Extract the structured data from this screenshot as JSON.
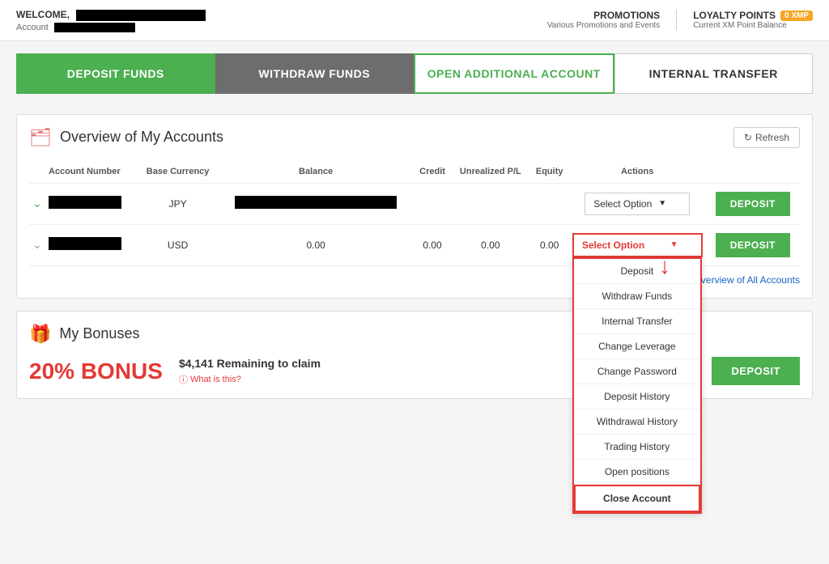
{
  "header": {
    "welcome_text": "WELCOME,",
    "account_label": "Account",
    "promotions_title": "PROMOTIONS",
    "promotions_sub": "Various Promotions and Events",
    "loyalty_title": "LOYALTY POINTS",
    "loyalty_badge": "0 XMP",
    "loyalty_sub": "Current XM Point Balance"
  },
  "nav": {
    "deposit": "DEPOSIT FUNDS",
    "withdraw": "WITHDRAW FUNDS",
    "open_account": "OPEN ADDITIONAL ACCOUNT",
    "transfer": "INTERNAL TRANSFER"
  },
  "accounts_section": {
    "title": "Overview of My Accounts",
    "refresh_label": "Refresh",
    "columns": {
      "account_number": "Account Number",
      "base_currency": "Base Currency",
      "balance": "Balance",
      "credit": "Credit",
      "unrealized_pl": "Unrealized P/L",
      "equity": "Equity",
      "actions": "Actions"
    },
    "rows": [
      {
        "currency": "JPY",
        "balance": "",
        "credit": "",
        "unrealized_pl": "",
        "equity": "",
        "select_label": "Select Option",
        "deposit_label": "DEPOSIT",
        "masked_balance": true
      },
      {
        "currency": "USD",
        "balance": "0.00",
        "credit": "0.00",
        "unrealized_pl": "0.00",
        "equity": "0.00",
        "select_label": "Select Option",
        "deposit_label": "DEPOSIT",
        "masked_balance": false,
        "dropdown_open": true
      }
    ],
    "show_all_label": "Show Overview of All Accounts"
  },
  "dropdown_options": [
    {
      "label": "Deposit",
      "highlighted": false
    },
    {
      "label": "Withdraw Funds",
      "highlighted": false
    },
    {
      "label": "Internal Transfer",
      "highlighted": false
    },
    {
      "label": "Change Leverage",
      "highlighted": false
    },
    {
      "label": "Change Password",
      "highlighted": false
    },
    {
      "label": "Deposit History",
      "highlighted": false
    },
    {
      "label": "Withdrawal History",
      "highlighted": false
    },
    {
      "label": "Trading History",
      "highlighted": false
    },
    {
      "label": "Open positions",
      "highlighted": false
    },
    {
      "label": "Close Account",
      "highlighted": true
    }
  ],
  "bonuses_section": {
    "title": "My Bonuses",
    "bonus_percent": "20% BONUS",
    "remaining_amount": "$4,141",
    "remaining_label": "Remaining to claim",
    "what_is_this": "What is this?",
    "deposit_label": "DEPOSIT"
  }
}
